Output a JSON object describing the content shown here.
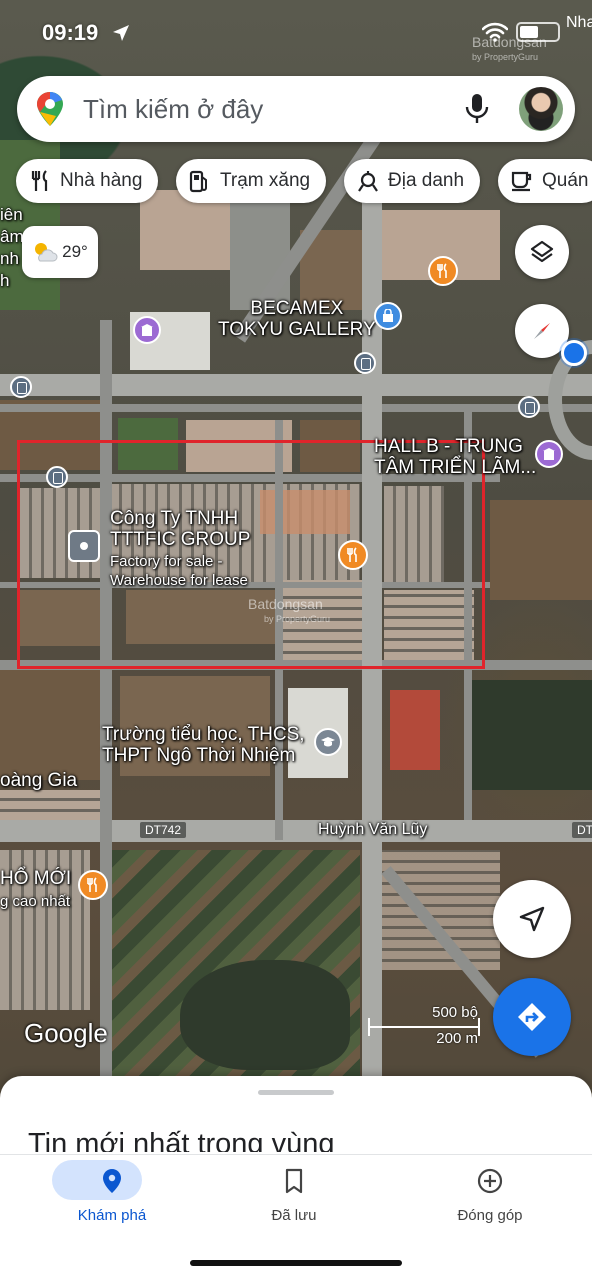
{
  "status_bar": {
    "time": "09:19",
    "overflow_text": "Nha"
  },
  "search": {
    "placeholder": "Tìm kiếm ở đây"
  },
  "chips": [
    {
      "label": "Nhà hàng",
      "icon": "fork-knife-icon"
    },
    {
      "label": "Trạm xăng",
      "icon": "gas-station-icon"
    },
    {
      "label": "Địa danh",
      "icon": "landmark-icon"
    },
    {
      "label": "Quán",
      "icon": "coffee-cup-icon"
    }
  ],
  "weather": {
    "temperature": "29°",
    "icon": "partly-cloudy-icon"
  },
  "map": {
    "watermark": "Batdongsan",
    "watermark_sub": "by PropertyGuru",
    "places": {
      "gallery": "BECAMEX\nTOKYU GALLERY",
      "hall": "HALL B - TRUNG\nTÂM TRIỂN LÃM...",
      "company_name": "Công Ty TNHH\nTTTFIC GROUP",
      "company_desc": "Factory for sale -\nWarehouse for lease",
      "school": "Trường tiểu học, THCS,\nTHPT Ngô Thời Nhiệm",
      "left_edge_1": "oàng Gia",
      "left_edge_2": "HỔ MỚI",
      "left_edge_3": "g cao nhất",
      "left_edge_top": "iên\nâm\nnh\nh"
    },
    "roads": {
      "main_road": "Huỳnh Văn Lũy",
      "shield_left": "DT742",
      "shield_right": "DT"
    },
    "logo": "Google",
    "scale": {
      "imperial": "500 bộ",
      "metric": "200 m"
    },
    "colors": {
      "selection_rect": "#e0242b",
      "primary": "#1a73e8"
    }
  },
  "sheet": {
    "title": "Tin mới nhất trong vùng"
  },
  "bottom_nav": [
    {
      "label": "Khám phá",
      "icon": "explore-pin-icon",
      "active": true
    },
    {
      "label": "Đã lưu",
      "icon": "bookmark-icon",
      "active": false
    },
    {
      "label": "Đóng góp",
      "icon": "add-circle-icon",
      "active": false
    }
  ]
}
